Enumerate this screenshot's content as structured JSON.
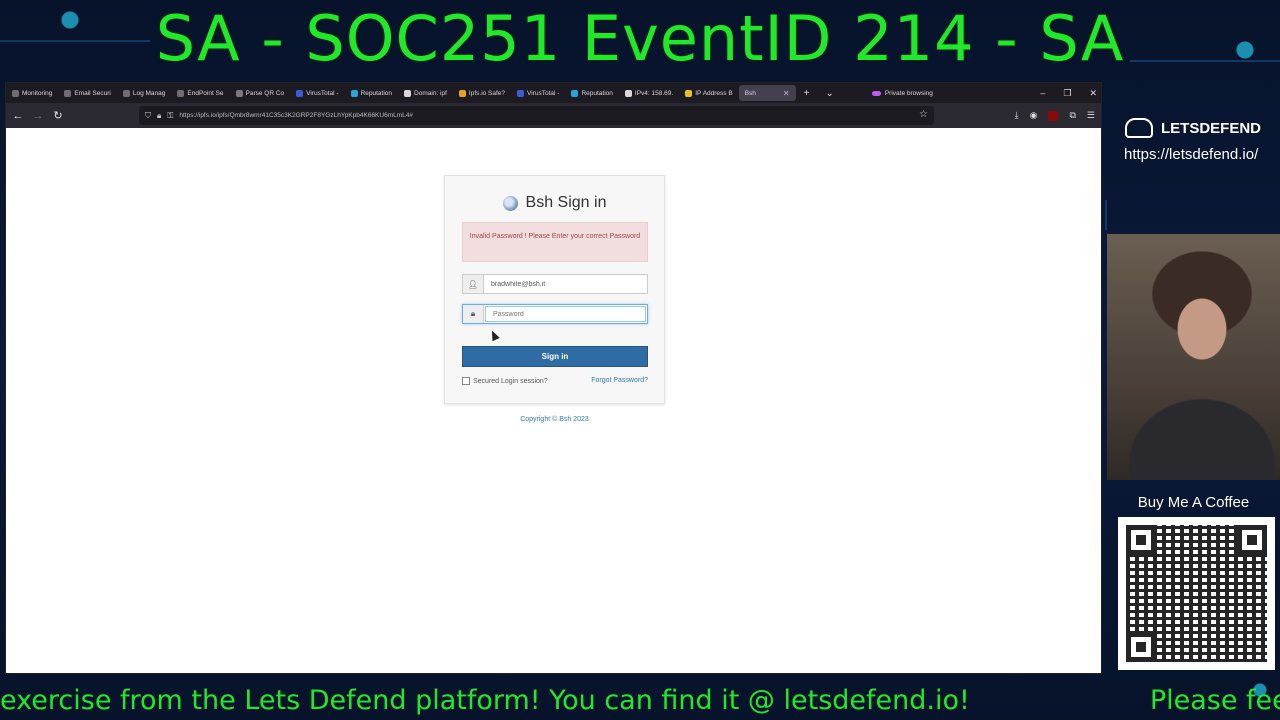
{
  "stream": {
    "title": "SA - SOC251 EventID 214 - SA",
    "ticker": [
      "exercise from the Lets Defend platform! You can find it @ letsdefend.io!",
      "Please feel free to reach out to"
    ],
    "brand": "LETSDEFEND",
    "brand_url": "https://letsdefend.io/",
    "coffee": "Buy Me A Coffee"
  },
  "browser": {
    "tabs": [
      {
        "label": "Monitoring",
        "color": "#6e6e6e"
      },
      {
        "label": "Email Securi",
        "color": "#6e6e6e"
      },
      {
        "label": "Log Manag",
        "color": "#6e6e6e"
      },
      {
        "label": "EndPoint Se",
        "color": "#6e6e6e"
      },
      {
        "label": "Parse QR Co",
        "color": "#7a7a7a"
      },
      {
        "label": "VirusTotal -",
        "color": "#3b5bd8"
      },
      {
        "label": "Reputation",
        "color": "#2aa3d8"
      },
      {
        "label": "Domain: ipf",
        "color": "#d8d8d8"
      },
      {
        "label": "Ipfs.io Safe?",
        "color": "#e8a020"
      },
      {
        "label": "VirusTotal -",
        "color": "#3b5bd8"
      },
      {
        "label": "Reputation",
        "color": "#2aa3d8"
      },
      {
        "label": "IPv4: 158.69.",
        "color": "#d8d8d8"
      },
      {
        "label": "IP Address B",
        "color": "#e8c020"
      },
      {
        "label": "Bsh",
        "color": "#42414d",
        "active": true
      }
    ],
    "private_label": "Private browsing",
    "url": "https://ipfs.io/ipfs/Qmbr8wmr41C35c3K2GRP2F8YGzLhYpKpb4K66KU6mLmL4#",
    "icons": {
      "back": "back-arrow-icon",
      "forward": "forward-arrow-icon",
      "reload": "reload-icon",
      "bookmark": "star-icon"
    }
  },
  "login": {
    "title": "Bsh Sign in",
    "alert": "Invalid Password ! Please Enter your correct Password",
    "email_value": "bradwhite@bsh.it",
    "password_placeholder": "Password",
    "signin_label": "Sign in",
    "remember_label": "Secured Login session?",
    "forgot_label": "Forgot Password?",
    "copyright": "Copyright © Bsh 2023"
  }
}
